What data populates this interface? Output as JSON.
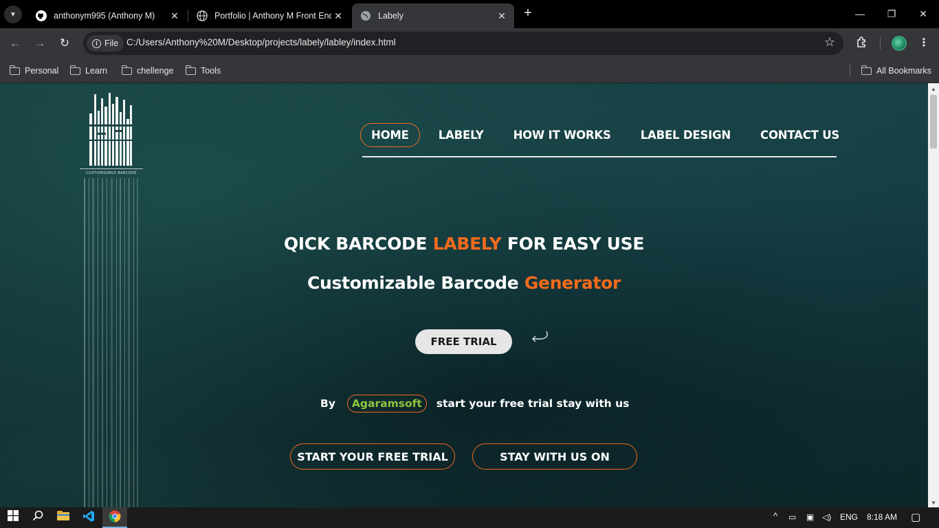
{
  "browser": {
    "tabs": [
      {
        "title": "anthonym995 (Anthony M)",
        "favicon": "github-icon",
        "active": false
      },
      {
        "title": "Portfolio | Anthony M Front End",
        "favicon": "globe-icon",
        "active": false
      },
      {
        "title": "Labely",
        "favicon": "globe-icon",
        "active": true
      }
    ],
    "address": {
      "chip_label": "File",
      "url": "C:/Users/Anthony%20M/Desktop/projects/labely/labley/index.html"
    },
    "bookmarks": [
      "Personal",
      "Learn",
      "chellenge",
      "Tools"
    ],
    "all_bookmarks_label": "All Bookmarks"
  },
  "page": {
    "logo": {
      "tagline": "CUSTOMIZABLE BARCODE"
    },
    "nav": [
      "HOME",
      "LABELY",
      "HOW IT WORKS",
      "LABEL DESIGN",
      "CONTACT US"
    ],
    "hero": {
      "title_pre": "QICK BARCODE ",
      "title_accent": "LABELY",
      "title_post": " FOR EASY USE",
      "subtitle_pre": "Customizable Barcode ",
      "subtitle_accent": "Generator",
      "trial_button": "FREE TRIAL"
    },
    "by_row": {
      "by": "By",
      "brand": "Agaramsoft",
      "text": "start your free trial stay with us"
    },
    "buttons": {
      "start_trial": "START YOUR FREE TRIAL",
      "stay": "STAY WITH US ON"
    }
  },
  "taskbar": {
    "language": "ENG",
    "time": "8:18 AM"
  },
  "colors": {
    "accent": "#f26b1d",
    "brand_green": "#8dc63f",
    "background": "#10303a"
  }
}
